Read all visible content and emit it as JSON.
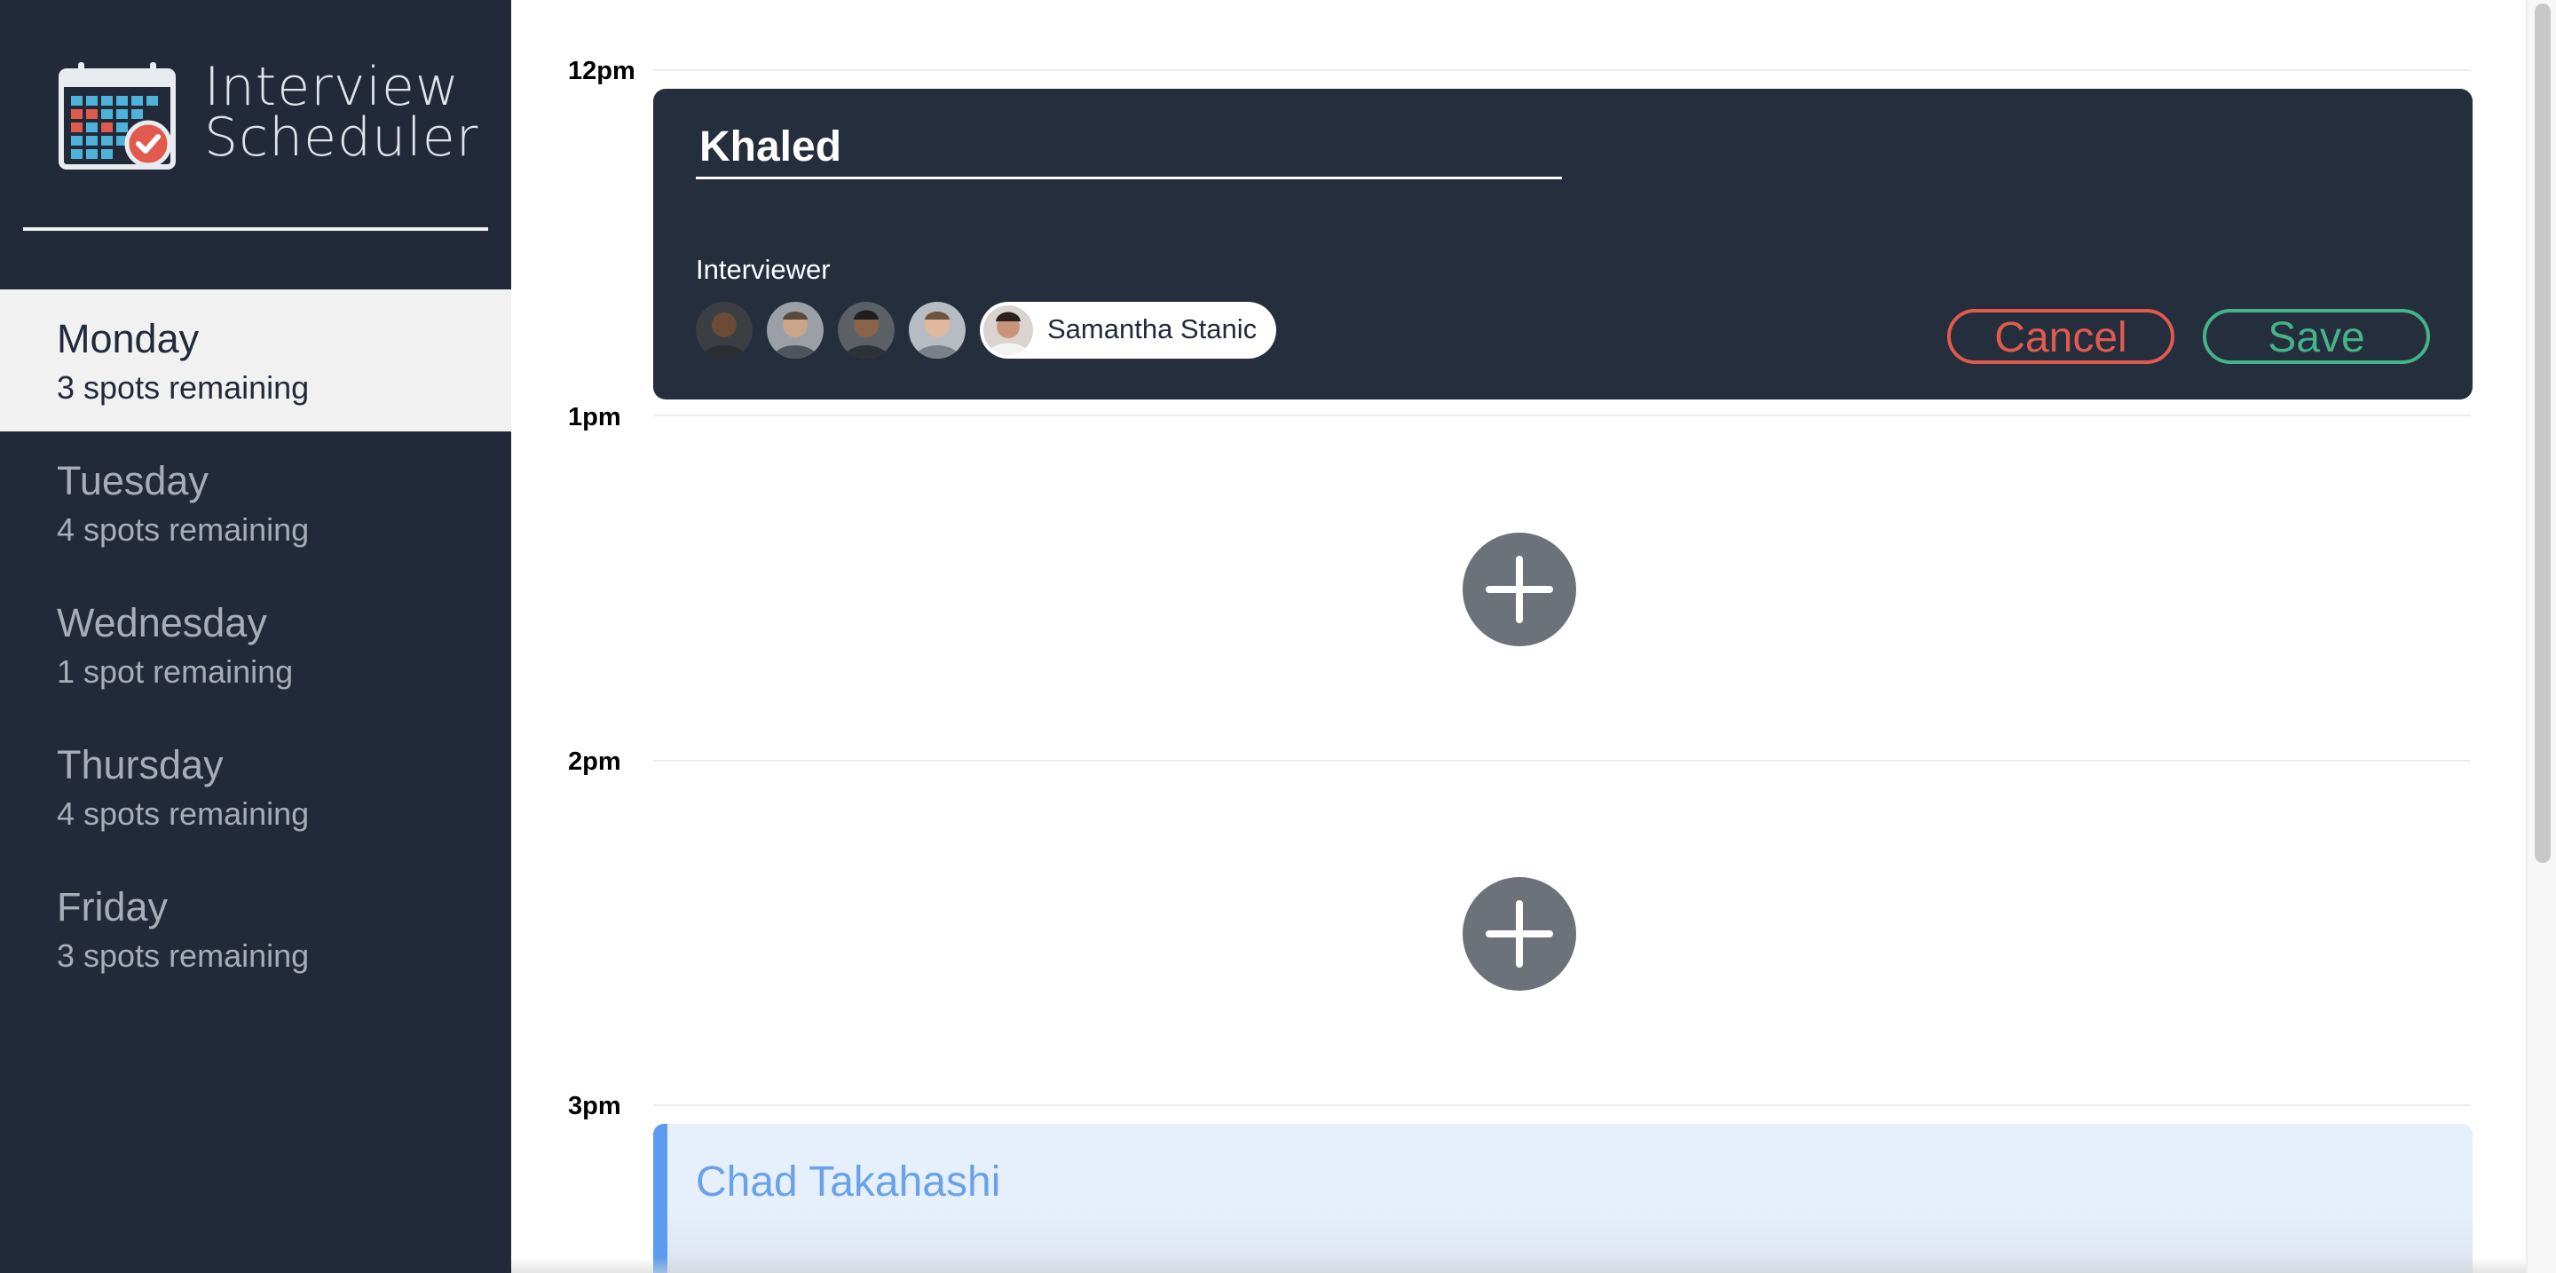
{
  "app": {
    "title": "Interview\nScheduler",
    "logo_icon": "calendar-check-icon"
  },
  "days": [
    {
      "name": "Monday",
      "spots": "3 spots remaining",
      "active": true
    },
    {
      "name": "Tuesday",
      "spots": "4 spots remaining",
      "active": false
    },
    {
      "name": "Wednesday",
      "spots": "1 spot remaining",
      "active": false
    },
    {
      "name": "Thursday",
      "spots": "4 spots remaining",
      "active": false
    },
    {
      "name": "Friday",
      "spots": "3 spots remaining",
      "active": false
    }
  ],
  "times": [
    "12pm",
    "1pm",
    "2pm",
    "3pm"
  ],
  "form": {
    "student_name": "Khaled",
    "interviewer_label": "Interviewer",
    "selected_interviewer": "Samantha Stanic",
    "cancel_label": "Cancel",
    "save_label": "Save"
  },
  "appointments": [
    {
      "student": "Chad Takahashi"
    }
  ],
  "colors": {
    "sidebar": "#222a3a",
    "form_bg": "#252e3d",
    "cancel": "#e15a4e",
    "save": "#45b38a",
    "show_accent": "#5b9cf0"
  }
}
